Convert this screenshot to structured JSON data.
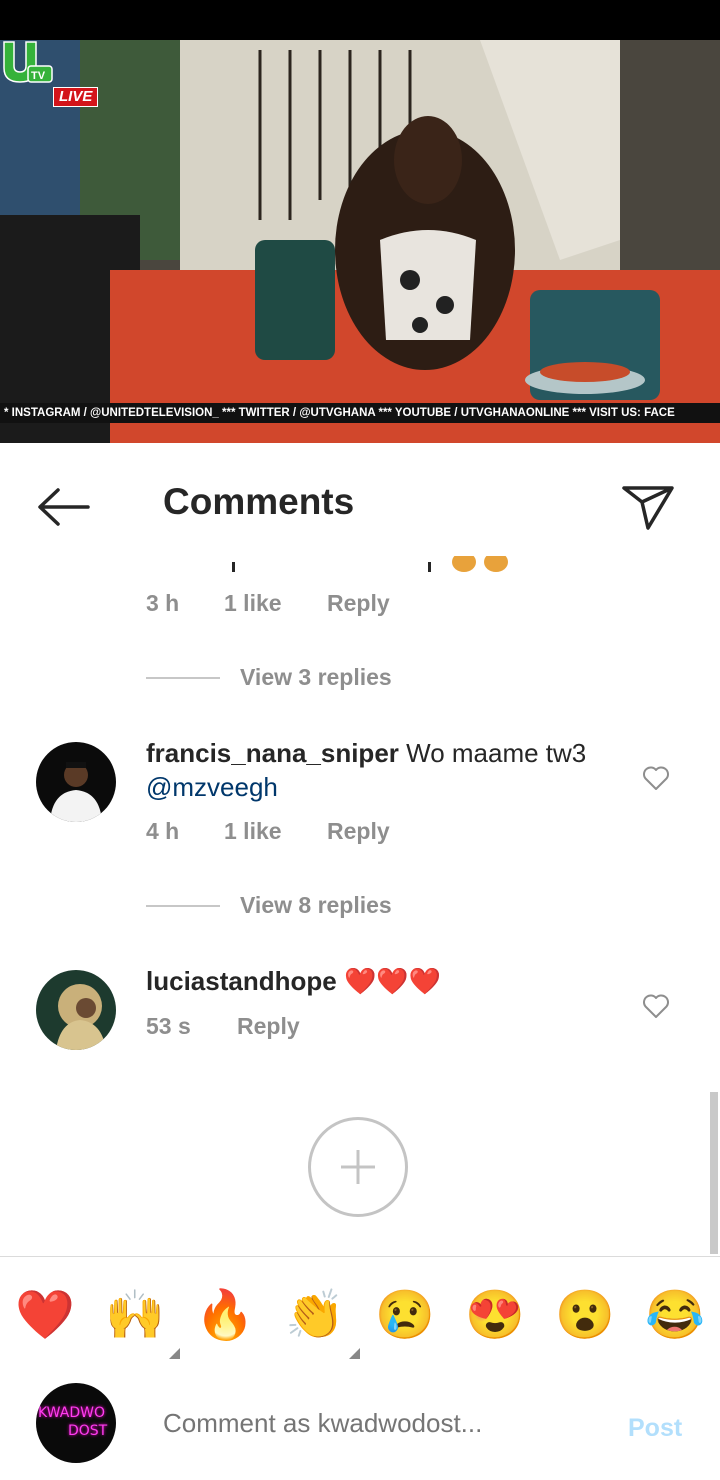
{
  "video": {
    "live_label": "LIVE",
    "ticker": "* INSTAGRAM / @UNITEDTELEVISION_ *** TWITTER / @UTVGHANA *** YOUTUBE / UTVGHANAONLINE *** VISIT US: FACE",
    "logo": "UTV"
  },
  "header": {
    "back_icon": "arrow-left-icon",
    "title": "Comments",
    "send_icon": "paper-plane-icon"
  },
  "comments": [
    {
      "time": "3 h",
      "likes": "1 like",
      "reply": "Reply",
      "view_replies": "View 3 replies"
    },
    {
      "username": "francis_nana_sniper",
      "text": "Wo maame tw3",
      "mention": "@mzveegh",
      "time": "4 h",
      "likes": "1 like",
      "reply": "Reply",
      "view_replies": "View 8 replies"
    },
    {
      "username": "luciastandhope",
      "text": "❤️❤️❤️",
      "time": "53 s",
      "reply": "Reply"
    }
  ],
  "emoji_bar": [
    "❤️",
    "🙌",
    "🔥",
    "👏",
    "😢",
    "😍",
    "😮",
    "😂"
  ],
  "composer": {
    "avatar_text_line1": "KWADWO",
    "avatar_text_line2": "DOST",
    "placeholder": "Comment as kwadwodost...",
    "post_label": "Post"
  },
  "colors": {
    "text": "#262626",
    "secondary": "#8e8e8e",
    "mention": "#00376b",
    "post_disabled": "#b2dffc",
    "heart": "#ed4956"
  }
}
